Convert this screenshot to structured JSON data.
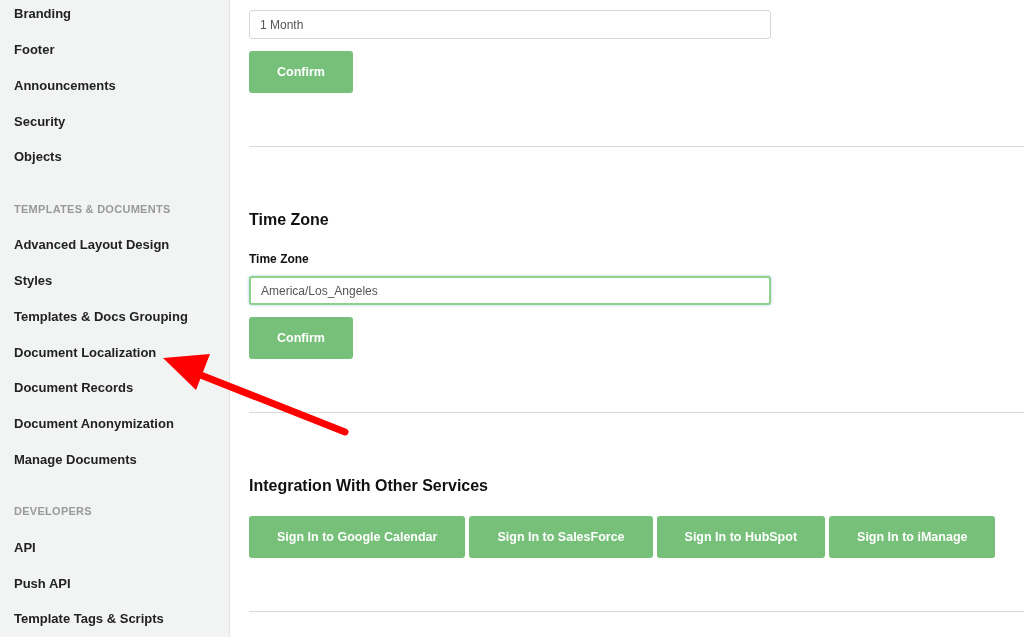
{
  "sidebar": {
    "items": [
      {
        "kind": "link",
        "label": "Branding"
      },
      {
        "kind": "link",
        "label": "Footer"
      },
      {
        "kind": "link",
        "label": "Announcements"
      },
      {
        "kind": "link",
        "label": "Security"
      },
      {
        "kind": "link",
        "label": "Objects"
      },
      {
        "kind": "header",
        "label": "TEMPLATES & DOCUMENTS"
      },
      {
        "kind": "link",
        "label": "Advanced Layout Design"
      },
      {
        "kind": "link",
        "label": "Styles"
      },
      {
        "kind": "link",
        "label": "Templates & Docs Grouping"
      },
      {
        "kind": "link",
        "label": "Document Localization"
      },
      {
        "kind": "link",
        "label": "Document Records"
      },
      {
        "kind": "link",
        "label": "Document Anonymization"
      },
      {
        "kind": "link",
        "label": "Manage Documents"
      },
      {
        "kind": "header",
        "label": "DEVELOPERS"
      },
      {
        "kind": "link",
        "label": "API"
      },
      {
        "kind": "link",
        "label": "Push API"
      },
      {
        "kind": "link",
        "label": "Template Tags & Scripts"
      }
    ]
  },
  "sections": [
    {
      "field": {
        "value": "1 Month",
        "focused": false
      },
      "buttons": [
        "Confirm"
      ]
    },
    {
      "title": "Time Zone",
      "field": {
        "label": "Time Zone",
        "value": "America/Los_Angeles",
        "focused": true
      },
      "buttons": [
        "Confirm"
      ]
    },
    {
      "title": "Integration With Other Services",
      "buttons": [
        "Sign In to Google Calendar",
        "Sign In to SalesForce",
        "Sign In to HubSpot",
        "Sign In to iManage"
      ]
    }
  ]
}
